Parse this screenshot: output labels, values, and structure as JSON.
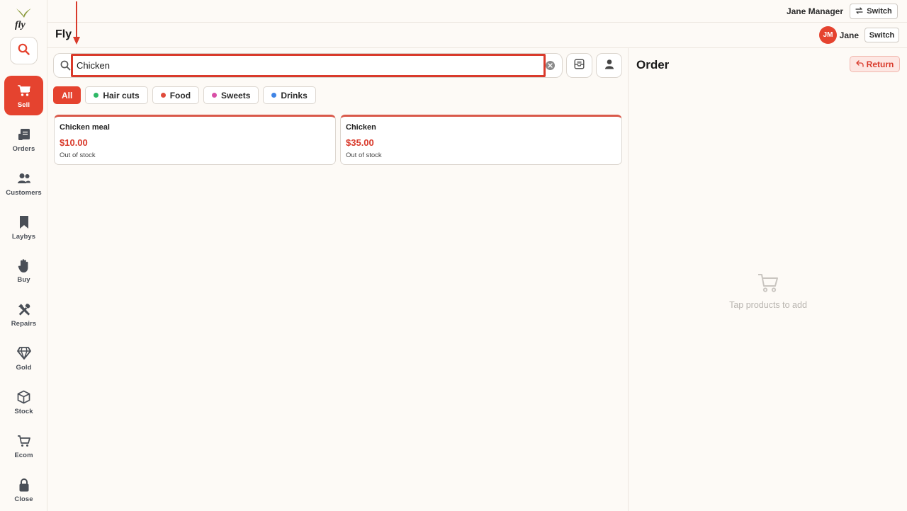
{
  "app": {
    "title": "Fly",
    "logo_text": "fly"
  },
  "topbar": {
    "user_full": "Jane Manager",
    "switch_label": "Switch"
  },
  "header": {
    "avatar_initials": "JM",
    "user_short": "Jane",
    "switch_label": "Switch"
  },
  "sidebar": {
    "items": [
      {
        "label": "Sell",
        "icon": "cart-icon",
        "active": true
      },
      {
        "label": "Orders",
        "icon": "receipt-icon"
      },
      {
        "label": "Customers",
        "icon": "users-icon"
      },
      {
        "label": "Laybys",
        "icon": "bookmark-icon"
      },
      {
        "label": "Buy",
        "icon": "hand-icon"
      },
      {
        "label": "Repairs",
        "icon": "tools-icon"
      },
      {
        "label": "Gold",
        "icon": "diamond-icon"
      },
      {
        "label": "Stock",
        "icon": "box-icon"
      },
      {
        "label": "Ecom",
        "icon": "shop-cart-icon"
      },
      {
        "label": "Close",
        "icon": "lock-icon"
      }
    ]
  },
  "search": {
    "value": "Chicken",
    "placeholder": ""
  },
  "categories": [
    {
      "label": "All",
      "active": true
    },
    {
      "label": "Hair cuts",
      "color": "#2db866"
    },
    {
      "label": "Food",
      "color": "#e04b3b"
    },
    {
      "label": "Sweets",
      "color": "#d84fa6"
    },
    {
      "label": "Drinks",
      "color": "#3f84e5"
    }
  ],
  "products": [
    {
      "name": "Chicken meal",
      "price": "$10.00",
      "stock": "Out of stock"
    },
    {
      "name": "Chicken",
      "price": "$35.00",
      "stock": "Out of stock"
    }
  ],
  "order": {
    "title": "Order",
    "return_label": "Return",
    "empty_text": "Tap products to add"
  },
  "colors": {
    "accent": "#e5432f",
    "highlight": "#d93a2b"
  }
}
